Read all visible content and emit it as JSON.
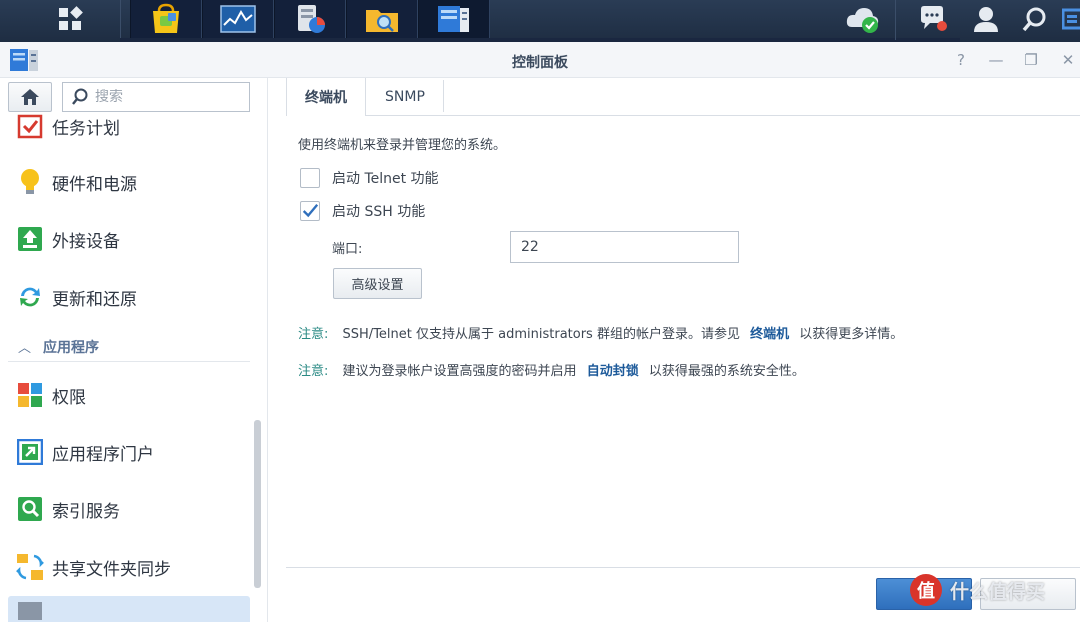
{
  "window": {
    "title": "控制面板",
    "controls": [
      "?",
      "—",
      "❐",
      "✕"
    ]
  },
  "taskbar": {
    "apps": [
      "main-menu",
      "package-center",
      "resource-monitor",
      "storage-manager",
      "file-station",
      "control-panel"
    ],
    "tray": [
      "cloud-status-icon",
      "chat-icon",
      "user-icon",
      "search-icon",
      "widgets-icon"
    ]
  },
  "sidebar": {
    "search_placeholder": "搜索",
    "items_top": [
      {
        "label": "任务计划",
        "icon": "task-scheduler-icon"
      },
      {
        "label": "硬件和电源",
        "icon": "lightbulb-icon"
      },
      {
        "label": "外接设备",
        "icon": "external-device-icon"
      },
      {
        "label": "更新和还原",
        "icon": "update-restore-icon"
      }
    ],
    "category": "应用程序",
    "items_apps": [
      {
        "label": "权限",
        "icon": "privileges-icon"
      },
      {
        "label": "应用程序门户",
        "icon": "app-portal-icon"
      },
      {
        "label": "索引服务",
        "icon": "indexing-service-icon"
      },
      {
        "label": "共享文件夹同步",
        "icon": "shared-folder-sync-icon"
      }
    ]
  },
  "main": {
    "tabs": [
      "终端机",
      "SNMP"
    ],
    "description": "使用终端机来登录并管理您的系统。",
    "telnet_label": "启动 Telnet 功能",
    "telnet_checked": false,
    "ssh_label": "启动 SSH 功能",
    "ssh_checked": true,
    "port_label": "端口:",
    "port_value": "22",
    "advanced_button": "高级设置",
    "note1": {
      "label": "注意:",
      "text_before": "SSH/Telnet 仅支持从属于 administrators 群组的帐户登录。请参见",
      "link": "终端机",
      "text_after": "以获得更多详情。"
    },
    "note2": {
      "label": "注意:",
      "text_before": "建议为登录帐户设置高强度的密码并启用",
      "link": "自动封锁",
      "text_after": "以获得最强的系统安全性。"
    }
  },
  "watermark": {
    "logo_text": "值",
    "text": "什么值得买"
  },
  "colors": {
    "taskbar": "#1e2d42",
    "accent": "#2f6fbc",
    "note_label": "#2a8a84",
    "link": "#1d5a9a",
    "selected": "#d7e6f7"
  }
}
